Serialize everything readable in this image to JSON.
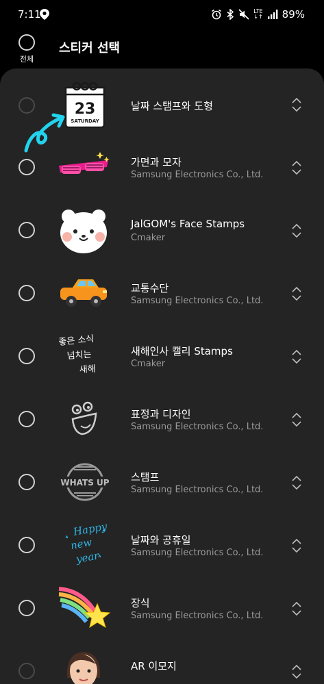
{
  "status_bar": {
    "time": "7:11",
    "battery": "89%",
    "network": "LTE"
  },
  "header": {
    "select_all_label": "전체",
    "title": "스티커 선택"
  },
  "items": [
    {
      "title": "날짜 스탬프와 도형",
      "subtitle": "",
      "icon": "calendar-stamp-icon",
      "calendar_day": "23",
      "calendar_weekday": "SATURDAY"
    },
    {
      "title": "가면과 모자",
      "subtitle": "Samsung Electronics Co., Ltd.",
      "icon": "party-glasses-icon"
    },
    {
      "title": "JalGOM's Face Stamps",
      "subtitle": "Cmaker",
      "icon": "bear-face-icon"
    },
    {
      "title": "교통수단",
      "subtitle": "Samsung Electronics Co., Ltd.",
      "icon": "car-icon"
    },
    {
      "title": "새해인사 캘리 Stamps",
      "subtitle": "Cmaker",
      "icon": "calligraphy-icon",
      "thumb_text": [
        "좋은 소식",
        "넘치는",
        "새해"
      ]
    },
    {
      "title": "표정과 디자인",
      "subtitle": "Samsung Electronics Co., Ltd.",
      "icon": "doodle-face-icon"
    },
    {
      "title": "스탬프",
      "subtitle": "Samsung Electronics Co., Ltd.",
      "icon": "whats-up-stamp-icon",
      "thumb_text": [
        "WHATS UP"
      ]
    },
    {
      "title": "날짜와 공휴일",
      "subtitle": "Samsung Electronics Co., Ltd.",
      "icon": "happy-new-year-icon",
      "thumb_text": [
        "Happy",
        "new",
        "year"
      ]
    },
    {
      "title": "장식",
      "subtitle": "Samsung Electronics Co., Ltd.",
      "icon": "shooting-star-icon"
    },
    {
      "title": "AR 이모지",
      "subtitle": "",
      "icon": "ar-emoji-icon"
    }
  ],
  "colors": {
    "background": "#000000",
    "panel": "#242424",
    "subtitle": "#9a9a9a",
    "checkbox_border": "#d3d3d3"
  }
}
